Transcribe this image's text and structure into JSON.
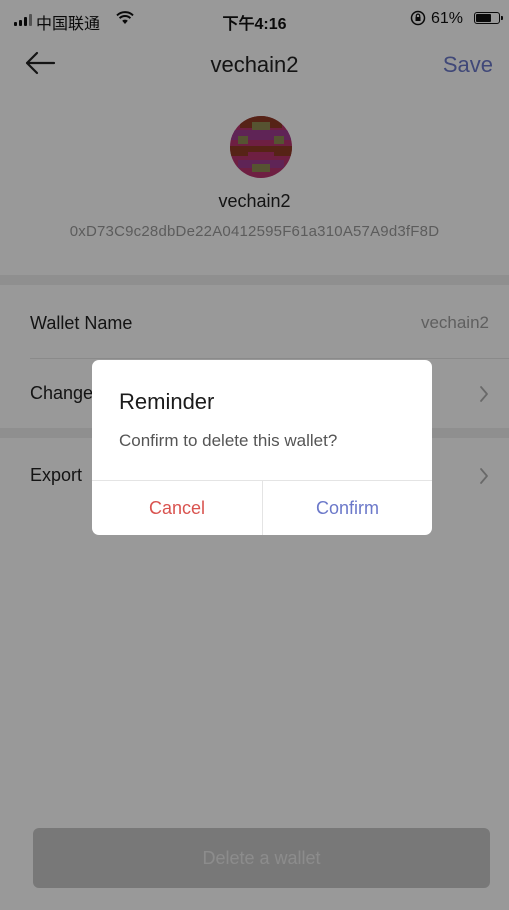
{
  "status_bar": {
    "carrier": "中国联通",
    "time": "下午4:16",
    "battery_percent": "61%",
    "battery_level": 0.61
  },
  "nav": {
    "title": "vechain2",
    "save_label": "Save",
    "back_icon": "arrow-left-icon"
  },
  "wallet": {
    "name": "vechain2",
    "address": "0xD73C9c28dbDe22A0412595F61a310A57A9d3fF8D",
    "avatar_colors": [
      "#b8346f",
      "#8f3b26",
      "#9f3c8f",
      "#8f8a52"
    ]
  },
  "settings": {
    "rows": [
      {
        "label": "Wallet Name",
        "value": "vechain2"
      },
      {
        "label": "Change"
      },
      {
        "label": "Export"
      }
    ]
  },
  "delete_button": {
    "label": "Delete a wallet"
  },
  "dialog": {
    "title": "Reminder",
    "message": "Confirm to delete this wallet?",
    "cancel_label": "Cancel",
    "confirm_label": "Confirm"
  },
  "colors": {
    "accent": "#6b78c9",
    "danger": "#d9534f"
  }
}
